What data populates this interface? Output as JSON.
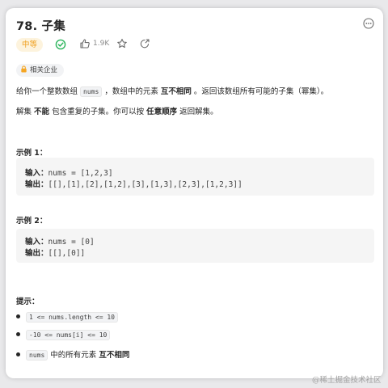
{
  "problem": {
    "title": "78. 子集",
    "difficulty": "中等",
    "like_count": "1.9K",
    "company_tag": "相关企业"
  },
  "description": {
    "p1_a": "给你一个整数数组 ",
    "p1_code": "nums",
    "p1_b": " ，数组中的元素 ",
    "p1_bold": "互不相同",
    "p1_c": " 。返回该数组所有可能的子集（幂集）。",
    "p2_a": "解集 ",
    "p2_bold1": "不能",
    "p2_b": " 包含重复的子集。你可以按 ",
    "p2_bold2": "任意顺序",
    "p2_c": " 返回解集。"
  },
  "examples": [
    {
      "title": "示例 1：",
      "input_label": "输入：",
      "input_value": "nums = [1,2,3]",
      "output_label": "输出：",
      "output_value": "[[],[1],[2],[1,2],[3],[1,3],[2,3],[1,2,3]]"
    },
    {
      "title": "示例 2：",
      "input_label": "输入：",
      "input_value": "nums = [0]",
      "output_label": "输出：",
      "output_value": "[[],[0]]"
    }
  ],
  "hints": {
    "title": "提示：",
    "item1_code": "1 <= nums.length <= 10",
    "item2_code": "-10 <= nums[i] <= 10",
    "item3_code": "nums",
    "item3_a": " 中的所有元素 ",
    "item3_bold": "互不相同"
  },
  "watermark": "@稀土掘金技术社区",
  "colors": {
    "difficulty_text": "#f0a020",
    "difficulty_bg": "#fdf3dd",
    "solved_green": "#2db55d",
    "lock_orange": "#f5a623"
  },
  "icons": [
    "more-icon",
    "solved-check-icon",
    "thumbs-up-icon",
    "star-icon",
    "share-icon",
    "lock-icon"
  ]
}
